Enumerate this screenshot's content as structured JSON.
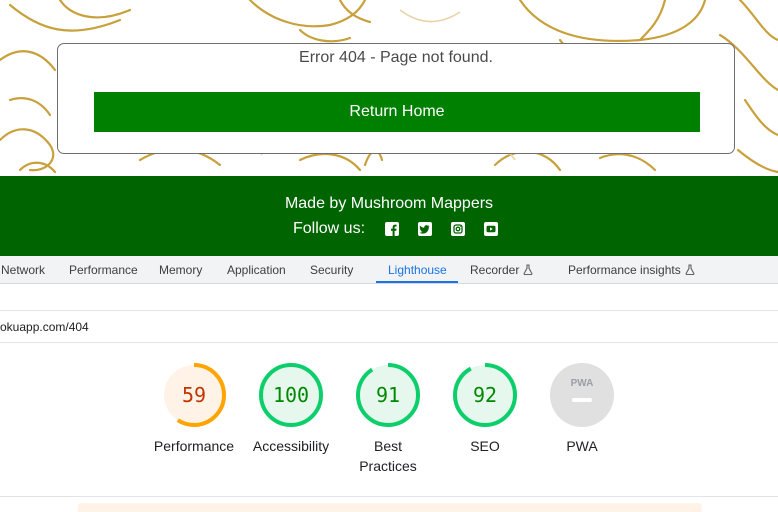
{
  "site": {
    "error_message": "Error 404 - Page not found.",
    "return_home_label": "Return Home",
    "footer": {
      "made_by": "Made by Mushroom Mappers",
      "follow_label": "Follow us:",
      "social_icons": [
        "facebook-icon",
        "twitter-icon",
        "instagram-icon",
        "youtube-icon"
      ]
    },
    "colors": {
      "button_green": "#008000",
      "footer_green": "#006400",
      "pattern_gold": "#c8a03c"
    }
  },
  "devtools": {
    "tabs": [
      {
        "label": "Network"
      },
      {
        "label": "Performance"
      },
      {
        "label": "Memory"
      },
      {
        "label": "Application"
      },
      {
        "label": "Security"
      },
      {
        "label": "Lighthouse",
        "active": true
      },
      {
        "label": "Recorder",
        "experimental": true
      },
      {
        "label": "Performance insights",
        "experimental": true
      }
    ],
    "url_text": "okuapp.com/404",
    "gauges": [
      {
        "name": "performance",
        "score": "59",
        "label": "Performance",
        "value": 0.59,
        "color": "#c33300",
        "ring": "#ffa400",
        "fill": "#fff3e8"
      },
      {
        "name": "accessibility",
        "score": "100",
        "label": "Accessibility",
        "value": 1.0,
        "color": "#008800",
        "ring": "#0cce6b",
        "fill": "#e6f8ed"
      },
      {
        "name": "best-practices",
        "score": "91",
        "label_line1": "Best",
        "label_line2": "Practices",
        "value": 0.91,
        "color": "#008800",
        "ring": "#0cce6b",
        "fill": "#e6f8ed"
      },
      {
        "name": "seo",
        "score": "92",
        "label": "SEO",
        "value": 0.92,
        "color": "#008800",
        "ring": "#0cce6b",
        "fill": "#e6f8ed"
      },
      {
        "name": "pwa",
        "badge_text": "PWA",
        "label": "PWA",
        "color": "#9aa0a6",
        "fill": "#e0e0e0"
      }
    ]
  }
}
